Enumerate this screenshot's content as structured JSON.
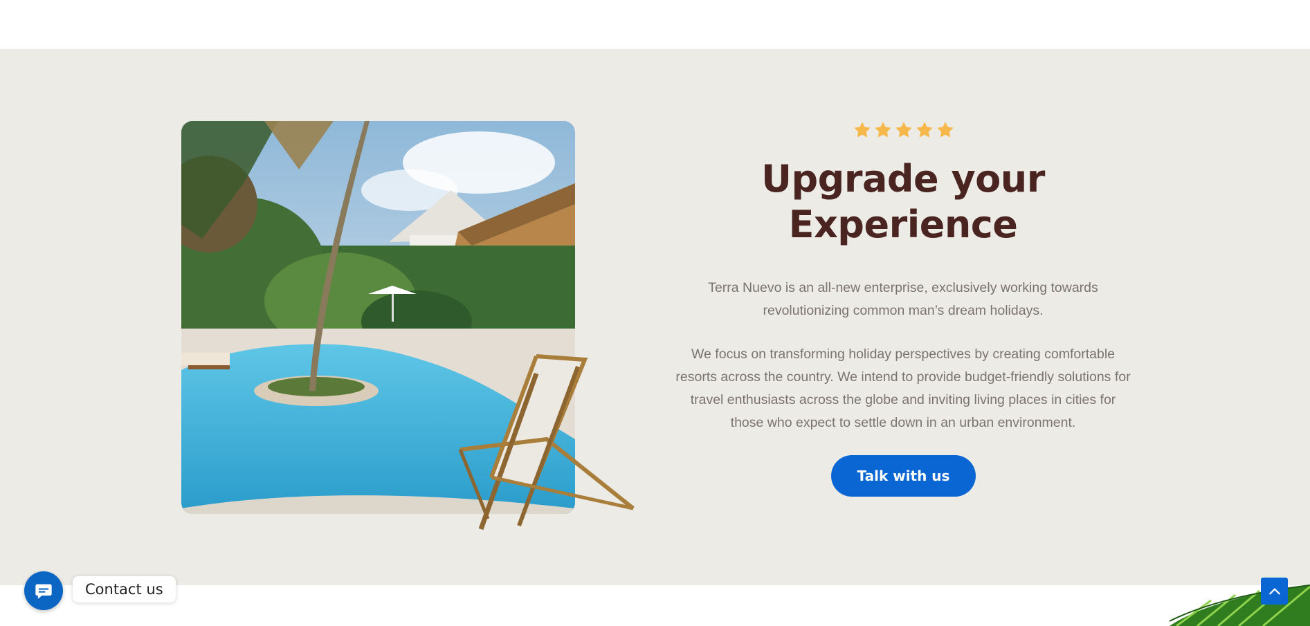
{
  "rating": {
    "stars": 5,
    "color": "#f7b84b"
  },
  "hero": {
    "title_line1": "Upgrade your",
    "title_line2": "Experience",
    "paragraph1": "Terra Nuevo is an all-new enterprise, exclusively working towards revolutionizing common man’s dream holidays.",
    "paragraph2": "We focus on transforming holiday perspectives by creating comfortable resorts across the country. We intend to provide budget-friendly solutions for travel enthusiasts across the globe and inviting living places in cities for those who expect to settle down in an urban environment.",
    "cta_label": "Talk with us"
  },
  "contact_widget": {
    "label": "Contact us"
  },
  "colors": {
    "accent": "#0a66d3",
    "heading": "#4a2420",
    "section_bg": "#edebe6",
    "body_text": "#7b736d"
  },
  "icons": {
    "contact": "chat-bubble-icon",
    "scroll_top": "chevron-up-icon",
    "star": "star-icon"
  }
}
